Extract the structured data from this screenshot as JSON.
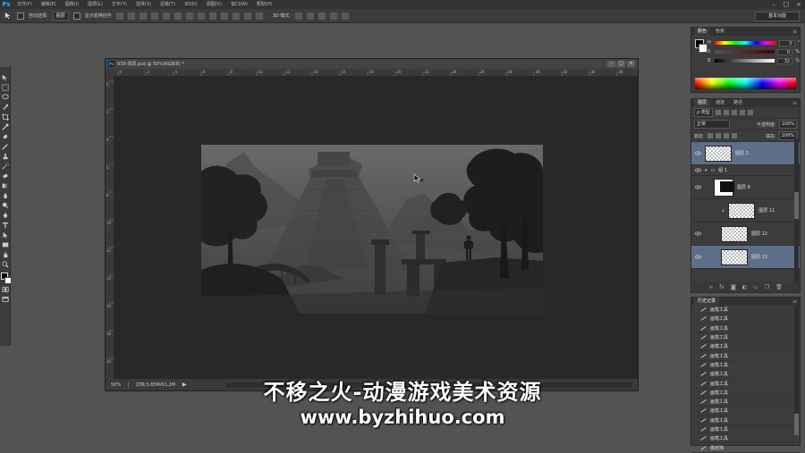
{
  "app": {
    "logo": "Ps"
  },
  "menubar": {
    "items": [
      "文件(F)",
      "编辑(E)",
      "图像(I)",
      "图层(L)",
      "文字(Y)",
      "选择(S)",
      "滤镜(T)",
      "3D(D)",
      "视图(V)",
      "窗口(W)",
      "帮助(H)"
    ],
    "window_controls": [
      "–",
      "□",
      "×"
    ]
  },
  "options_bar": {
    "auto_select_label": "自动选择:",
    "auto_select_value": "图层",
    "show_transform_label": "显示变换控件",
    "mode_3d_label": "3D 模式:",
    "workspace": "基本功能"
  },
  "document": {
    "title": "030-郊原.psd @ 50%(RGB/8) *",
    "window_controls": [
      "–",
      "□",
      "×"
    ],
    "status_zoom": "50%",
    "status_doc": "文档:3.65M/61.2M",
    "ruler_ticks_h": [
      "0",
      "2",
      "4",
      "6",
      "8",
      "10",
      "12",
      "14",
      "16",
      "18",
      "20",
      "22",
      "24",
      "26",
      "28",
      "30",
      "32",
      "34",
      "36"
    ],
    "ruler_ticks_v": [
      "0",
      "2",
      "4",
      "6",
      "8",
      "10",
      "12",
      "14",
      "16",
      "18",
      "20"
    ]
  },
  "color_panel": {
    "tabs": [
      "颜色",
      "色板"
    ],
    "channels": [
      {
        "name": "H",
        "value": "0",
        "unit": "°"
      },
      {
        "name": "S",
        "value": "0",
        "unit": "%"
      },
      {
        "name": "B",
        "value": "32",
        "unit": "%"
      }
    ]
  },
  "layers_panel": {
    "tabs": [
      "图层",
      "通道",
      "路径"
    ],
    "filter_kind": "ρ 类型",
    "blend_mode": "正常",
    "opacity_label": "不透明度:",
    "opacity_value": "100%",
    "lock_label": "锁定:",
    "fill_label": "填充:",
    "fill_value": "100%",
    "layers": [
      {
        "name": "图层 2",
        "selected": true,
        "type": "pixel"
      },
      {
        "name": "组 1",
        "selected": false,
        "type": "group"
      },
      {
        "name": "图层 8",
        "selected": false,
        "type": "mask"
      },
      {
        "name": "图层 11",
        "selected": false,
        "type": "pixel"
      },
      {
        "name": "图层 12",
        "selected": false,
        "type": "pixel"
      },
      {
        "name": "图层 13",
        "selected": true,
        "type": "pixel"
      }
    ],
    "footer_icons": [
      "link-icon",
      "fx-icon",
      "mask-icon",
      "adjustment-icon",
      "folder-icon",
      "new-layer-icon",
      "trash-icon"
    ]
  },
  "history_panel": {
    "tabs": [
      "历史记录"
    ],
    "items": [
      "画笔工具",
      "画笔工具",
      "画笔工具",
      "画笔工具",
      "画笔工具",
      "画笔工具",
      "画笔工具",
      "画笔工具",
      "画笔工具",
      "画笔工具",
      "画笔工具",
      "画笔工具",
      "画笔工具",
      "画笔工具",
      "画笔工具",
      "橡皮擦"
    ]
  },
  "watermark": {
    "line1": "不移之火-动漫游戏美术资源",
    "line2": "www.byzhihuo.com"
  },
  "colors": {
    "selection": "#5d6f88",
    "ps_blue": "#31a8ff"
  }
}
